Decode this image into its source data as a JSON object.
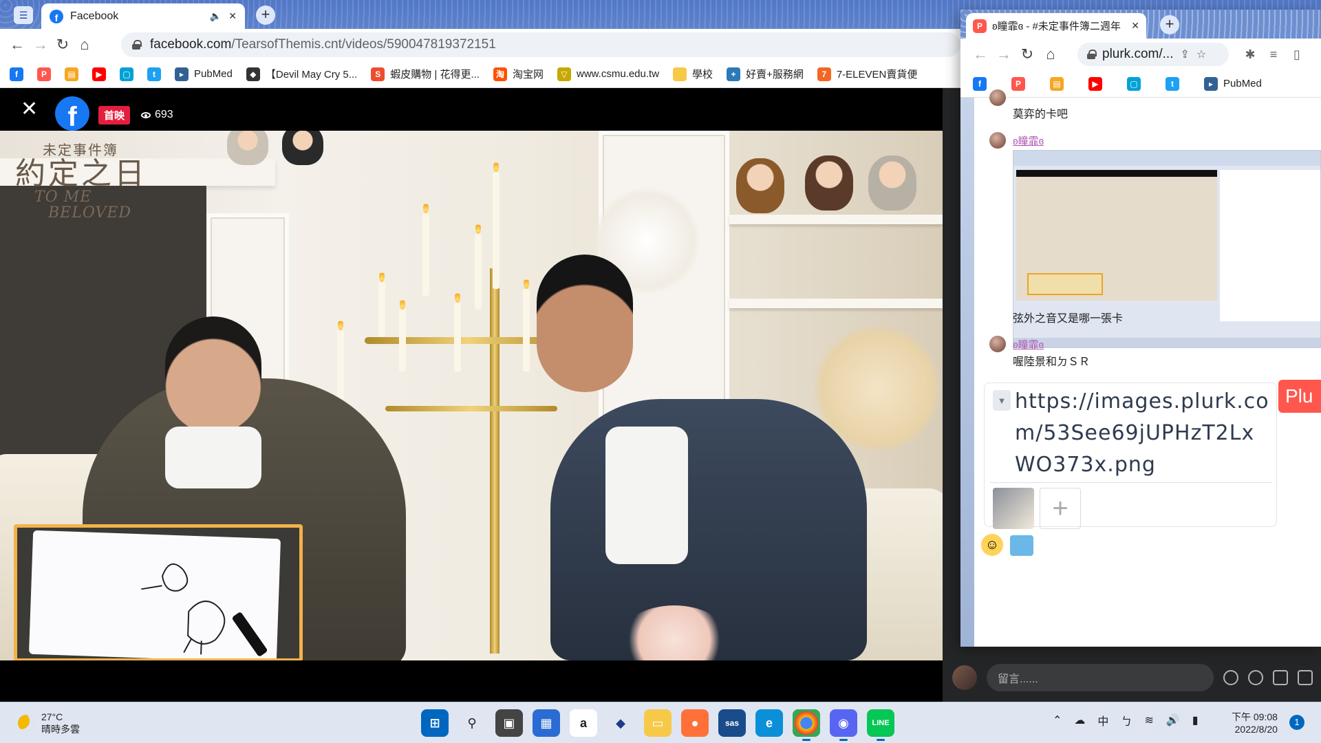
{
  "main_window": {
    "tab_title": "Facebook",
    "url_host": "facebook.com",
    "url_path": "/TearsofThemis.cnt/videos/590047819372151",
    "bookmarks": [
      {
        "label": "",
        "icon": "facebook-icon",
        "color": "#1877f2"
      },
      {
        "label": "",
        "icon": "plurk-icon",
        "color": "#ff574d"
      },
      {
        "label": "",
        "icon": "bookmark-icon",
        "color": "#f5a623"
      },
      {
        "label": "",
        "icon": "youtube-icon",
        "color": "#ff0000"
      },
      {
        "label": "",
        "icon": "bilibili-icon",
        "color": "#00a1d6"
      },
      {
        "label": "",
        "icon": "twitter-icon",
        "color": "#1da1f2"
      },
      {
        "label": "PubMed",
        "icon": "pubmed-icon",
        "color": "#326295"
      },
      {
        "label": "【Devil May Cry 5...",
        "icon": "ninja-icon",
        "color": "#333333"
      },
      {
        "label": "蝦皮購物 | 花得更...",
        "icon": "shopee-icon",
        "color": "#ee4d2d"
      },
      {
        "label": "淘宝网",
        "icon": "taobao-icon",
        "color": "#ff5000"
      },
      {
        "label": "www.csmu.edu.tw",
        "icon": "csmu-icon",
        "color": "#c8a800"
      },
      {
        "label": "學校",
        "icon": "folder-icon",
        "color": "#f7c948"
      },
      {
        "label": "好賣+服務網",
        "icon": "haomai-icon",
        "color": "#2a7ab8"
      },
      {
        "label": "7-ELEVEN賣貨便",
        "icon": "seven-eleven-icon",
        "color": "#f26722"
      }
    ]
  },
  "video": {
    "badge": "首映",
    "viewers": "693",
    "logo_cn_small": "未定事件簿",
    "logo_cn_big": "約定之日",
    "logo_en_1": "TO ME",
    "logo_en_2": "BELOVED"
  },
  "fb_comment": {
    "placeholder": "留言......"
  },
  "plurk_window": {
    "tab_title": "ʚ瞳霏ɞ - #未定事件簿二週年",
    "url": "plurk.com/...",
    "bookmarks": [
      {
        "label": "",
        "icon": "facebook-icon"
      },
      {
        "label": "",
        "icon": "plurk-icon"
      },
      {
        "label": "",
        "icon": "bookmark-icon"
      },
      {
        "label": "",
        "icon": "youtube-icon"
      },
      {
        "label": "",
        "icon": "bilibili-icon"
      },
      {
        "label": "",
        "icon": "twitter-icon"
      },
      {
        "label": "PubMed",
        "icon": "pubmed-icon"
      }
    ],
    "messages": [
      {
        "user": "",
        "text": "莫弈的卡吧"
      },
      {
        "user": "ʚ瞳霏ɞ",
        "text": "弦外之音又是哪一張卡"
      },
      {
        "user": "ʚ瞳霏ɞ",
        "text": "喔陸景和ㄉＳＲ"
      }
    ],
    "compose_text": "https://images.plurk.com/53See69jUPHzT2LxWO373x.png",
    "plurk_button": "Plu"
  },
  "taskbar": {
    "temperature": "27°C",
    "weather": "晴時多雲",
    "ime": "中",
    "ime2": "ㄅ",
    "time": "下午 09:08",
    "date": "2022/8/20",
    "notifications": "1"
  }
}
